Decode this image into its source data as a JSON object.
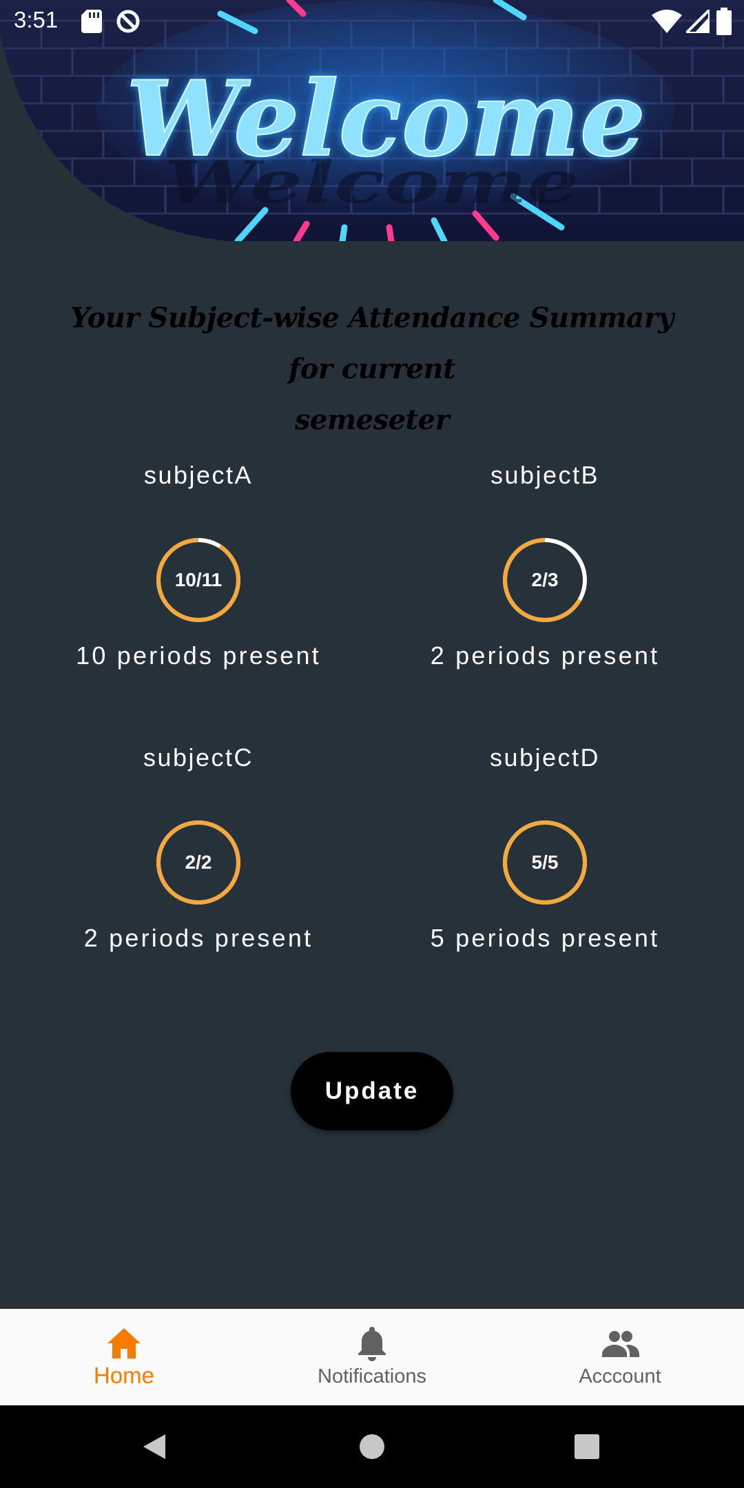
{
  "status_bar": {
    "time": "3:51"
  },
  "banner": {
    "text": "Welcome"
  },
  "heading": {
    "line1": "Your Subject-wise Attendance Summary for current",
    "line2": "semeseter"
  },
  "subjects": [
    {
      "name": "subjectA",
      "fraction": "10/11",
      "periods": "10 periods present",
      "ratio": 0.909
    },
    {
      "name": "subjectB",
      "fraction": "2/3",
      "periods": "2 periods present",
      "ratio": 0.667
    },
    {
      "name": "subjectC",
      "fraction": "2/2",
      "periods": "2 periods present",
      "ratio": 1.0
    },
    {
      "name": "subjectD",
      "fraction": "5/5",
      "periods": "5 periods present",
      "ratio": 1.0
    }
  ],
  "update_button": {
    "label": "Update"
  },
  "bottom_nav": {
    "items": [
      {
        "label": "Home",
        "icon": "home-icon",
        "active": true
      },
      {
        "label": "Notifications",
        "icon": "bell-icon",
        "active": false
      },
      {
        "label": "Acccount",
        "icon": "people-icon",
        "active": false
      }
    ]
  },
  "colors": {
    "background": "#273139",
    "ring_progress": "#f5a83c",
    "ring_track": "#ffffff",
    "nav_active": "#f57c00",
    "nav_inactive": "#616161",
    "button_bg": "#000000"
  }
}
